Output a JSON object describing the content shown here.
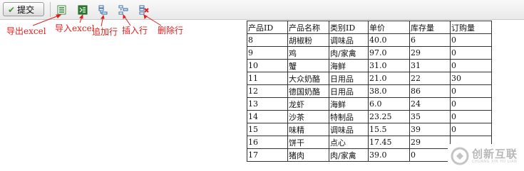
{
  "toolbar": {
    "submit_label": "提交",
    "icons": {
      "export": "export-excel-icon",
      "import": "import-excel-icon",
      "append": "append-row-icon",
      "insert": "insert-row-icon",
      "delete": "delete-row-icon"
    }
  },
  "annotations": {
    "export": "导出excel",
    "import": "导入excel",
    "append": "追加行",
    "insert": "插入行",
    "delete": "删除行",
    "color": "#e02020"
  },
  "table": {
    "headers": [
      "产品ID",
      "产品名称",
      "类别ID",
      "单价",
      "库存量",
      "订购量"
    ],
    "rows": [
      [
        "8",
        "胡椒粉",
        "调味品",
        "40.0",
        "6",
        "0"
      ],
      [
        "9",
        "鸡",
        "肉/家禽",
        "97.0",
        "29",
        "0"
      ],
      [
        "10",
        "蟹",
        "海鲜",
        "31.0",
        "31",
        "0"
      ],
      [
        "11",
        "大众奶酪",
        "日用品",
        "21.0",
        "22",
        "30"
      ],
      [
        "12",
        "德国奶酪",
        "日用品",
        "38.0",
        "86",
        "0"
      ],
      [
        "13",
        "龙虾",
        "海鲜",
        "6.0",
        "24",
        "0"
      ],
      [
        "14",
        "沙茶",
        "特制品",
        "23.25",
        "35",
        "0"
      ],
      [
        "15",
        "味精",
        "调味品",
        "15.5",
        "39",
        "0"
      ],
      [
        "16",
        "饼干",
        "点心",
        "17.45",
        "29",
        ""
      ],
      [
        "17",
        "猪肉",
        "肉/家禽",
        "39.0",
        "0",
        ""
      ]
    ]
  },
  "watermark": {
    "text": "创新互联",
    "sub": "CHUANG XIN HU LIAN"
  }
}
